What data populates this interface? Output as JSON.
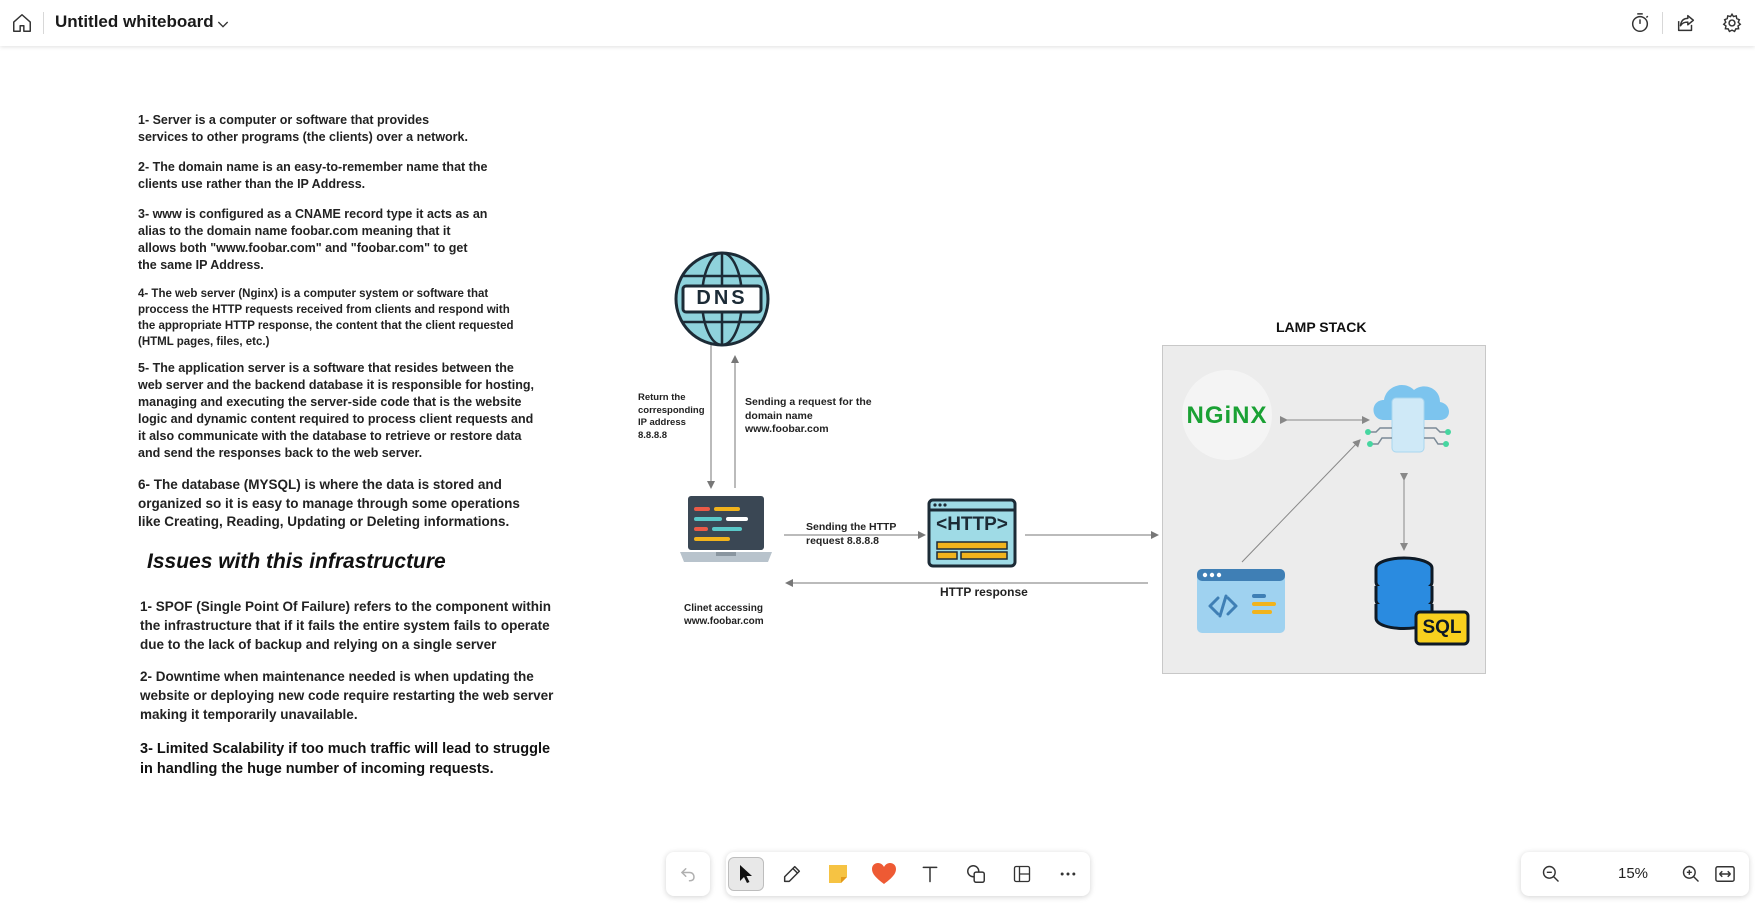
{
  "topbar": {
    "title": "Untitled whiteboard"
  },
  "notes": {
    "n1": "1- Server is a computer or software that provides\nservices to other programs (the clients) over a network.",
    "n2": "2- The domain name is an easy-to-remember name that the\nclients use  rather than the IP Address.",
    "n3": "3- www is configured as a CNAME record type it acts as an\nalias to the domain name foobar.com meaning that it\nallows both \"www.foobar.com\" and \"foobar.com\" to get\nthe same IP Address.",
    "n4": "4- The web server (Nginx) is a computer system or software that\nproccess the HTTP requests received from clients and respond with\nthe appropriate HTTP response, the content that the client requested\n(HTML pages, files, etc.)",
    "n5": "5- The application server is a software that resides between the\nweb server and the backend database it is responsible for hosting,\nmanaging and executing the server-side code that is the website\nlogic and dynamic content required to process client requests and\nit also communicate with the database to retrieve or restore data\nand send the responses back to the web server.",
    "n6": "6- The database (MYSQL)  is where the data is stored and\norganized so it is easy to manage through some operations\nlike Creating, Reading, Updating or Deleting informations."
  },
  "issues": {
    "title": "Issues with this infrastructure",
    "i1": "1- SPOF (Single Point Of Failure) refers to the component within\nthe infrastructure that if it fails the entire system fails to operate\ndue to the lack of backup and relying on a single server",
    "i2": "2- Downtime when maintenance needed is when updating the\nwebsite or deploying new code require restarting the web server\nmaking it temporarily unavailable.",
    "i3": "3- Limited Scalability if too much traffic will lead to struggle\nin handling the huge number of incoming requests."
  },
  "diagram": {
    "dns_text": "DNS",
    "return_label": "Return the\ncorresponding\nIP address\n8.8.8.8",
    "request_label": "Sending a request for the\ndomain name\nwww.foobar.com",
    "client_label": "Clinet accessing\nwww.foobar.com",
    "http_request_label": "Sending the HTTP\nrequest 8.8.8.8",
    "http_text": "<HTTP>",
    "http_response_label": "HTTP response",
    "lamp_title": "LAMP STACK",
    "nginx_text": "NGiNX",
    "sql_text": "SQL"
  },
  "zoom": {
    "level": "15%"
  }
}
